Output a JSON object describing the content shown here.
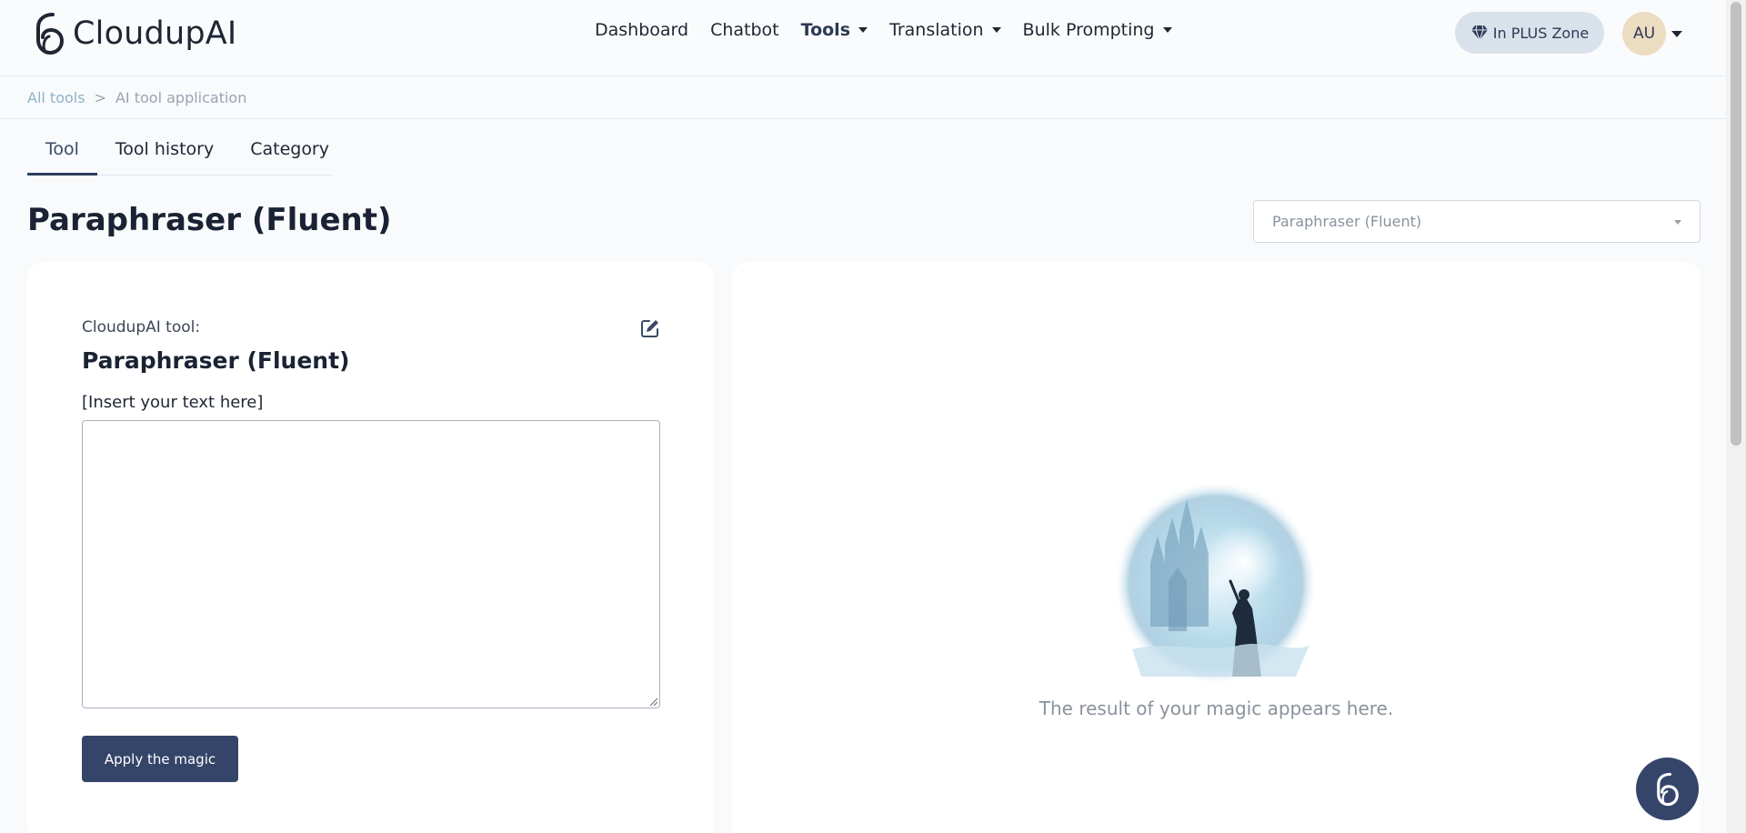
{
  "app": {
    "name": "CloudupAI"
  },
  "nav": {
    "items": [
      {
        "label": "Dashboard",
        "dropdown": false,
        "active": false
      },
      {
        "label": "Chatbot",
        "dropdown": false,
        "active": false
      },
      {
        "label": "Tools",
        "dropdown": true,
        "active": true
      },
      {
        "label": "Translation",
        "dropdown": true,
        "active": false
      },
      {
        "label": "Bulk Prompting",
        "dropdown": true,
        "active": false
      }
    ]
  },
  "header": {
    "plus_badge": "In PLUS Zone",
    "avatar_initials": "AU"
  },
  "breadcrumb": {
    "link": "All tools",
    "separator": ">",
    "current": "AI tool application"
  },
  "tabs": [
    {
      "label": "Tool",
      "active": true
    },
    {
      "label": "Tool history",
      "active": false
    },
    {
      "label": "Category",
      "active": false
    }
  ],
  "page": {
    "title": "Paraphraser (Fluent)",
    "tool_select_value": "Paraphraser (Fluent)"
  },
  "tool_card": {
    "label": "CloudupAI tool:",
    "name": "Paraphraser (Fluent)",
    "input_label": "[Insert your text here]",
    "input_value": "",
    "apply_button": "Apply the magic"
  },
  "result_card": {
    "placeholder": "The result of your magic appears here."
  },
  "icons": {
    "logo": "cloudupai-logo-icon",
    "diamond": "diamond-icon",
    "edit": "edit-icon",
    "chat": "chat-fab-icon"
  },
  "colors": {
    "primary": "#35456a",
    "badge_bg": "#d9e2ea",
    "avatar_bg": "#ecdcc1",
    "breadcrumb_link": "#8fb4c9",
    "muted_text": "#8a929c"
  }
}
